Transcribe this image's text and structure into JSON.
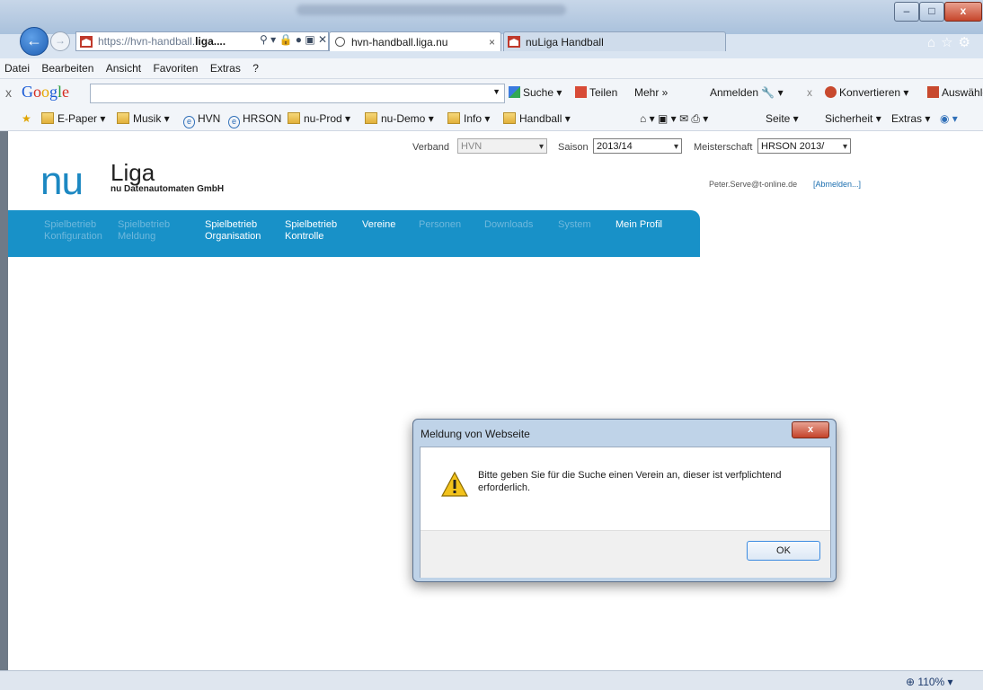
{
  "browser": {
    "address_prefix": "https://",
    "address_host": "hvn-handball.",
    "address_rest": "liga....",
    "tabs": [
      {
        "label": "hvn-handball.liga.nu",
        "close": "×"
      },
      {
        "label": "nuLiga Handball",
        "close": "×"
      }
    ]
  },
  "menu": [
    "Datei",
    "Bearbeiten",
    "Ansicht",
    "Favoriten",
    "Extras",
    "?"
  ],
  "google_bar": {
    "close": "x",
    "logo": [
      "G",
      "o",
      "o",
      "g",
      "l",
      "e"
    ],
    "search_value": "",
    "suche": "Suche ▾",
    "teilen": "Teilen",
    "mehr": "Mehr »",
    "anmelden": "Anmelden",
    "x2": "x",
    "konvertieren": "Konvertieren",
    "auswaehlen": "Auswählen"
  },
  "bookmarks": [
    {
      "label": "E-Paper ▾",
      "type": "folder"
    },
    {
      "label": "Musik ▾",
      "type": "folder"
    },
    {
      "label": "HVN",
      "type": "page"
    },
    {
      "label": "HRSON",
      "type": "page"
    },
    {
      "label": "nu-Prod ▾",
      "type": "folder"
    },
    {
      "label": "nu-Demo ▾",
      "type": "folder"
    },
    {
      "label": "Info ▾",
      "type": "folder"
    },
    {
      "label": "Handball ▾",
      "type": "folder"
    }
  ],
  "command_bar": {
    "seite": "Seite ▾",
    "sicherheit": "Sicherheit ▾",
    "extras": "Extras ▾"
  },
  "page": {
    "verband_label": "Verband",
    "verband_value": "HVN",
    "saison_label": "Saison",
    "saison_value": "2013/14",
    "meisterschaft_label": "Meisterschaft",
    "meisterschaft_value": "HRSON 2013/",
    "logo_nu": "nu",
    "logo_liga": "Liga",
    "logo_sub": "nu Datenautomaten GmbH",
    "user_email": "Peter.Serve@t-online.de",
    "logout": "[Abmelden...]",
    "nav": [
      {
        "l1": "Spielbetrieb",
        "l2": "Konfiguration",
        "active": false
      },
      {
        "l1": "Spielbetrieb",
        "l2": "Meldung",
        "active": false
      },
      {
        "l1": "Spielbetrieb",
        "l2": "Organisation",
        "active": true
      },
      {
        "l1": "Spielbetrieb",
        "l2": "Kontrolle",
        "active": true
      },
      {
        "l1": "Vereine",
        "l2": "",
        "active": true
      },
      {
        "l1": "Personen",
        "l2": "",
        "active": false
      },
      {
        "l1": "Downloads",
        "l2": "",
        "active": false
      },
      {
        "l1": "System",
        "l2": "",
        "active": false
      },
      {
        "l1": "Mein Profil",
        "l2": "",
        "active": true
      }
    ]
  },
  "dialog": {
    "title": "Meldung von Webseite",
    "close": "x",
    "message": "Bitte geben Sie für die Suche einen Verein an, dieser ist verfplichtend erforderlich.",
    "ok": "OK"
  },
  "status": {
    "zoom": "110%"
  }
}
